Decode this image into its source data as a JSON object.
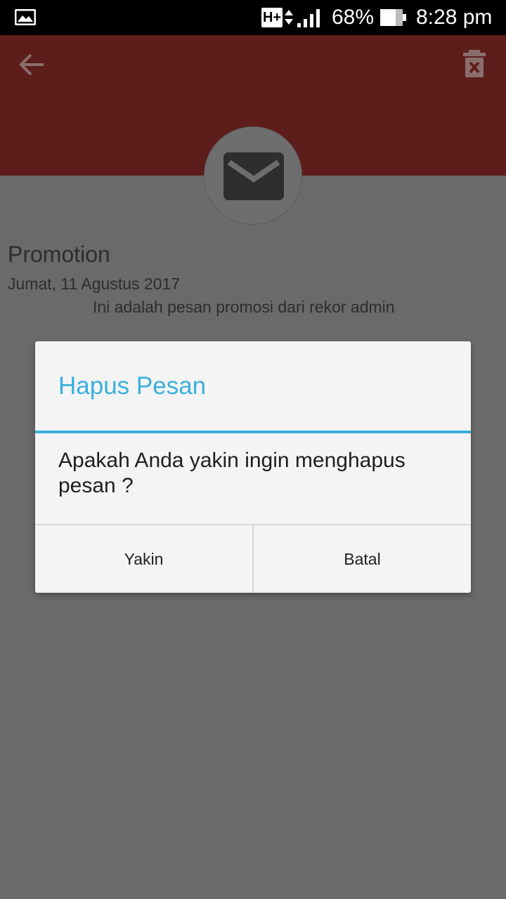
{
  "status_bar": {
    "network": "H+",
    "battery_percent": "68%",
    "time": "8:28 pm",
    "icons": [
      "gallery-icon",
      "hplus-icon",
      "data-arrows-icon",
      "signal-icon",
      "battery-icon"
    ]
  },
  "header": {
    "back_icon": "arrow-left-icon",
    "delete_icon": "trash-icon",
    "color": "#5d1e1b"
  },
  "message": {
    "icon": "envelope-icon",
    "title": "Promotion",
    "date": "Jumat, 11 Agustus 2017",
    "body": "Ini adalah pesan promosi dari rekor admin"
  },
  "dialog": {
    "title": "Hapus Pesan",
    "message": "Apakah Anda yakin ingin menghapus pesan ?",
    "confirm_label": "Yakin",
    "cancel_label": "Batal",
    "accent": "#3ab0dc"
  }
}
